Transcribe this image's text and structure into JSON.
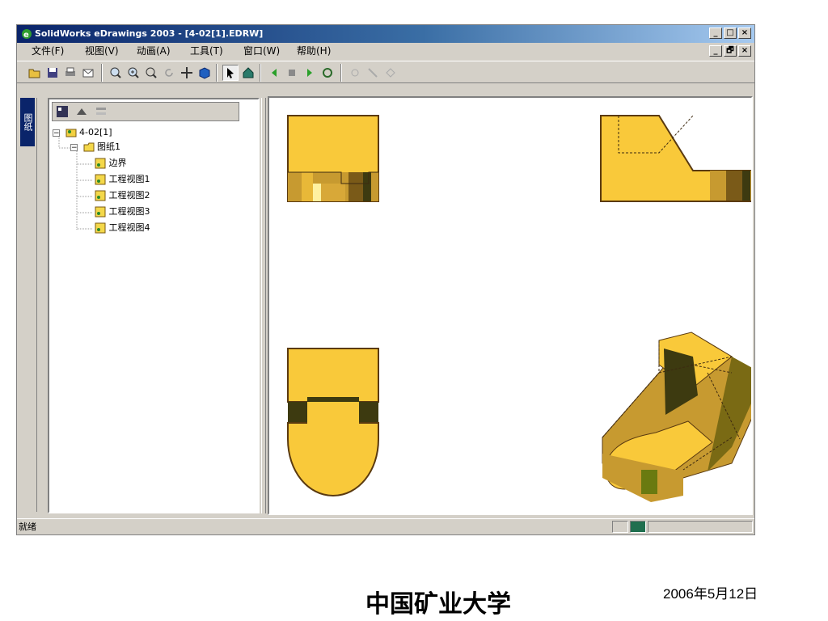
{
  "window": {
    "title": "SolidWorks eDrawings 2003 - [4-02[1].EDRW]",
    "buttons": {
      "minimize": "_",
      "maximize": "□",
      "close": "×"
    },
    "mdi_buttons": {
      "minimize": "_",
      "restore": "🗗",
      "close": "×"
    }
  },
  "menu": [
    {
      "label": "文件(F)"
    },
    {
      "label": "视图(V)"
    },
    {
      "label": "动画(A)"
    },
    {
      "label": "工具(T)"
    },
    {
      "label": "窗口(W)"
    },
    {
      "label": "帮助(H)"
    }
  ],
  "toolbar": {
    "icons": [
      "open-icon",
      "save-icon",
      "print-icon",
      "send-icon",
      "zoom-to-fit-icon",
      "zoom-in-icon",
      "zoom-area-icon",
      "rotate-icon",
      "pan-icon",
      "shaded-icon",
      "select-icon",
      "home-icon",
      "previous-icon",
      "stop-icon",
      "play-icon",
      "loop-icon",
      "measure-icon",
      "markup-icon",
      "hide-icon"
    ]
  },
  "sidebar": {
    "tab_label": "图纸"
  },
  "tree": {
    "root": "4-02[1]",
    "sheet": "图纸1",
    "items": [
      "边界",
      "工程视图1",
      "工程视图2",
      "工程视图3",
      "工程视图4"
    ]
  },
  "status": {
    "text": "就绪"
  },
  "footer": {
    "title": "中国矿业大学",
    "date": "2006年5月12日"
  },
  "colors": {
    "part_face": "#f9c93a",
    "part_dark": "#3d3a10",
    "part_mid": "#c79a30",
    "outline": "#5a3a10",
    "title_bar": "#0a246a"
  }
}
